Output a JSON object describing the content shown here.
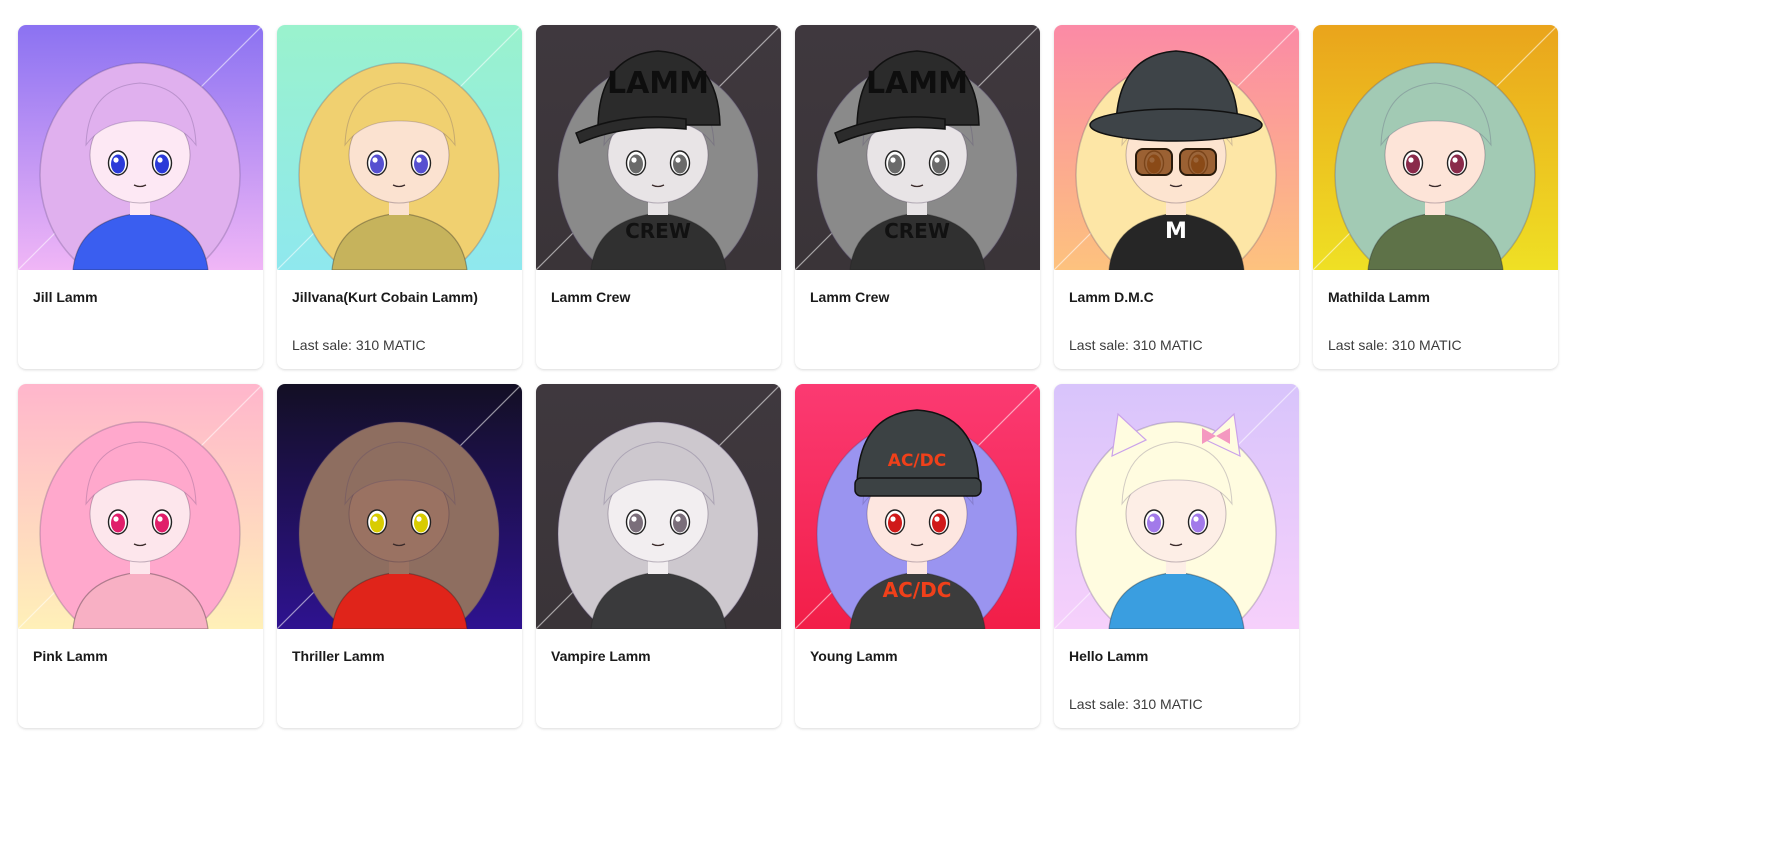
{
  "collection": {
    "items": [
      {
        "name": "Jill Lamm",
        "last_sale": "",
        "bg_top": "#8b72f2",
        "bg_bottom": "#f0b6f6",
        "hair": "#e0b0ee",
        "skin": "#fde8f4",
        "eye": "#2b3ad8",
        "outfit": "#3a5ef0",
        "hat": "",
        "hat_text": "",
        "shirt_text": "",
        "glasses": false,
        "ears": false
      },
      {
        "name": "Jillvana(Kurt Cobain Lamm)",
        "last_sale": "Last sale: 310 MATIC",
        "bg_top": "#9af2cd",
        "bg_bottom": "#8fe8ee",
        "hair": "#f0d070",
        "skin": "#fbe2d0",
        "eye": "#5650d0",
        "outfit": "#c6b35c",
        "hat": "",
        "hat_text": "",
        "shirt_text": "",
        "glasses": false,
        "ears": false
      },
      {
        "name": "Lamm Crew",
        "last_sale": "",
        "bg_top": "#3f383e",
        "bg_bottom": "#3a3438",
        "hair": "#8a8a8a",
        "skin": "#e8e4e6",
        "eye": "#6a6a6a",
        "outfit": "#303030",
        "hat": "#2b2b2b",
        "hat_text": "LAMM",
        "shirt_text": "CREW",
        "glasses": false,
        "ears": false
      },
      {
        "name": "Lamm Crew",
        "last_sale": "",
        "bg_top": "#3f383e",
        "bg_bottom": "#3a3438",
        "hair": "#8a8a8a",
        "skin": "#e8e4e6",
        "eye": "#6a6a6a",
        "outfit": "#303030",
        "hat": "#2b2b2b",
        "hat_text": "LAMM",
        "shirt_text": "CREW",
        "glasses": false,
        "ears": false
      },
      {
        "name": "Lamm D.M.C",
        "last_sale": "Last sale: 310 MATIC",
        "bg_top": "#fb8aa6",
        "bg_bottom": "#fdc27e",
        "hair": "#fde6a6",
        "skin": "#fde4d0",
        "eye": "#8a4a1a",
        "outfit": "#262626",
        "hat": "#3e4448",
        "hat_text": "",
        "shirt_text": "M",
        "glasses": true,
        "ears": false
      },
      {
        "name": "Mathilda Lamm",
        "last_sale": "Last sale: 310 MATIC",
        "bg_top": "#eaa41c",
        "bg_bottom": "#efe024",
        "hair": "#a2cab4",
        "skin": "#fde4d8",
        "eye": "#8a2a4a",
        "outfit": "#5e7248",
        "hat": "",
        "hat_text": "",
        "shirt_text": "",
        "glasses": false,
        "ears": false
      },
      {
        "name": "Pink Lamm",
        "last_sale": "",
        "bg_top": "#ffb6cc",
        "bg_bottom": "#fff0b8",
        "hair": "#ffa8cc",
        "skin": "#fde6ec",
        "eye": "#e01e6a",
        "outfit": "#f8b0c4",
        "hat": "",
        "hat_text": "",
        "shirt_text": "",
        "glasses": false,
        "ears": false
      },
      {
        "name": "Thriller Lamm",
        "last_sale": "",
        "bg_top": "#130f24",
        "bg_bottom": "#2e1290",
        "hair": "#8e6e60",
        "skin": "#9a7262",
        "eye": "#d8cc00",
        "outfit": "#e0241a",
        "hat": "",
        "hat_text": "",
        "shirt_text": "",
        "glasses": false,
        "ears": false
      },
      {
        "name": "Vampire Lamm",
        "last_sale": "",
        "bg_top": "#3f383e",
        "bg_bottom": "#3a3438",
        "hair": "#cdc8ce",
        "skin": "#f2eef0",
        "eye": "#7a6e7a",
        "outfit": "#3a3a3c",
        "hat": "",
        "hat_text": "",
        "shirt_text": "",
        "glasses": false,
        "ears": false
      },
      {
        "name": "Young Lamm",
        "last_sale": "",
        "bg_top": "#fb3a72",
        "bg_bottom": "#f21e48",
        "hair": "#9a94f0",
        "skin": "#fde6e0",
        "eye": "#d01a1a",
        "outfit": "#3c3c3c",
        "hat": "#3c4244",
        "hat_text": "AC/DC",
        "shirt_text": "AC/DC",
        "glasses": false,
        "ears": false
      },
      {
        "name": "Hello Lamm",
        "last_sale": "Last sale: 310 MATIC",
        "bg_top": "#d8c4fb",
        "bg_bottom": "#f6d0fb",
        "hair": "#fffce0",
        "skin": "#fdeee6",
        "eye": "#a27aea",
        "outfit": "#3a9ee0",
        "hat": "",
        "hat_text": "",
        "shirt_text": "",
        "glasses": false,
        "ears": true
      }
    ]
  }
}
